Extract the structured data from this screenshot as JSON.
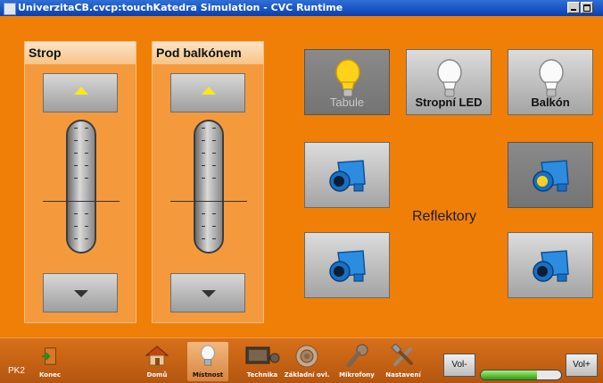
{
  "window": {
    "title": "UniverzitaCB.cvcp:touchKatedra Simulation - CVC Runtime"
  },
  "sliders": [
    {
      "label": "Strop"
    },
    {
      "label": "Pod balkónem"
    }
  ],
  "lights": [
    {
      "label": "Tabule",
      "active": true
    },
    {
      "label": "Stropní LED",
      "active": false
    },
    {
      "label": "Balkón",
      "active": false
    }
  ],
  "reflectors": {
    "label": "Reflektory"
  },
  "bottom": {
    "station": "PK2",
    "exit_label": "Konec",
    "nav": [
      {
        "label": "Domů",
        "icon": "home-icon"
      },
      {
        "label": "Místnost",
        "icon": "bulb-icon",
        "active": true
      },
      {
        "label": "Technika",
        "icon": "monitor-icon"
      },
      {
        "label": "Základní ovl.",
        "icon": "speaker-icon"
      },
      {
        "label": "Mikrofony",
        "icon": "microphone-icon"
      },
      {
        "label": "Nastavení",
        "icon": "tools-icon"
      }
    ],
    "vol_down": "Vol-",
    "vol_up": "Vol+",
    "volume_percent": 70
  },
  "colors": {
    "background": "#f07f07",
    "accent_yellow": "#f8e81c"
  }
}
